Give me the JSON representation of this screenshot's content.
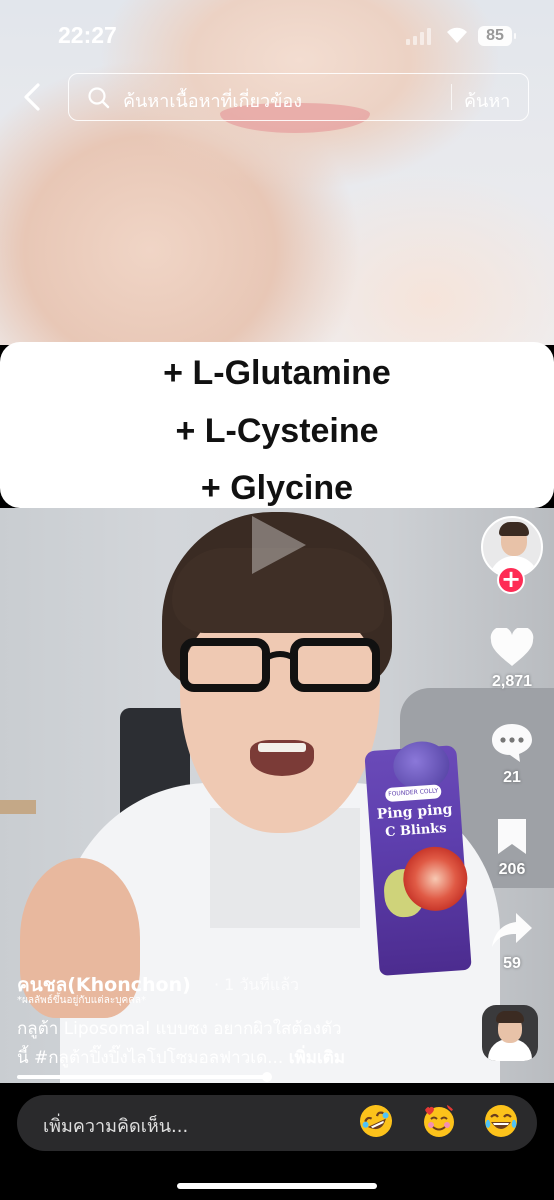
{
  "status_bar": {
    "time": "22:27",
    "battery": "85"
  },
  "search": {
    "placeholder": "ค้นหาเนื้อหาที่เกี่ยวข้อง",
    "button_label": "ค้นหา"
  },
  "video_caption": {
    "lines": [
      "+ L-Glutamine",
      "+ L-Cysteine",
      "+ Glycine"
    ]
  },
  "product_packet": {
    "brand": "FOUNDER COLLY",
    "title_1": "Ping ping",
    "title_2": "C Blinks"
  },
  "side_actions": {
    "likes": "2,871",
    "comments": "21",
    "saves": "206",
    "shares": "59"
  },
  "post": {
    "author": "คนชล(Khonchon)",
    "time": "· 1 วันที่แล้ว",
    "disclaimer": "*ผลลัพธ์ขึ้นอยู่กับแต่ละบุคคล*",
    "description_line1": "กลูต้า Liposomal แบบซง อยากผิวใสต้องตัว",
    "description_line2": "นี้ #กลูต้าปิ๊งปิ๊งไลโปโซมอลฟาวเด...",
    "more_label": "เพิ่มเติม"
  },
  "video_progress": 0.48,
  "comment_bar": {
    "placeholder": "เพิ่มความคิดเห็น..."
  },
  "icons": [
    "back-icon",
    "search-icon",
    "play-icon",
    "heart-icon",
    "comment-icon",
    "bookmark-icon",
    "share-icon",
    "rofl-emoji-icon",
    "smiling-hearts-emoji-icon",
    "laughing-emoji-icon"
  ],
  "colors": {
    "accent": "#fe2c55",
    "comment_bg": "#2a2a2c"
  }
}
